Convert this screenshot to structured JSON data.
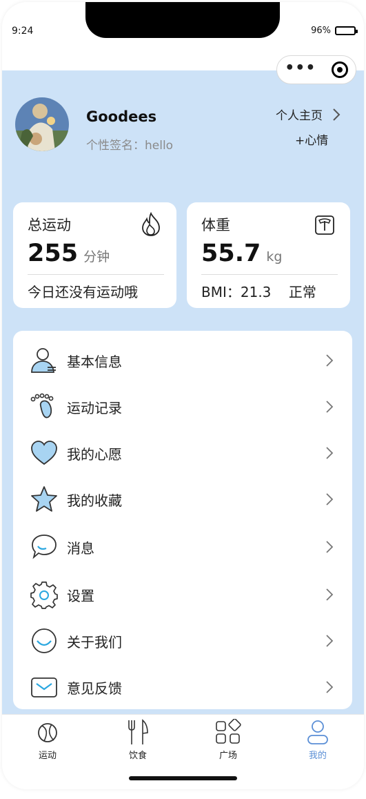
{
  "status": {
    "time": "9:24",
    "battery": "96%",
    "battery_level": 0.96
  },
  "profile": {
    "name": "Goodees",
    "signature": "个性签名：hello",
    "homepage_label": "个人主页",
    "mood_label": "+心情"
  },
  "cards": {
    "exercise": {
      "title": "总运动",
      "value": "255",
      "unit": "分钟",
      "footer": "今日还没有运动哦",
      "icon": "flame-icon"
    },
    "weight": {
      "title": "体重",
      "value": "55.7",
      "unit": "kg",
      "footer": "BMI：21.3    正常",
      "icon": "scale-icon"
    }
  },
  "menu": {
    "items": [
      {
        "label": "基本信息",
        "icon": "user-info-icon"
      },
      {
        "label": "运动记录",
        "icon": "footprint-icon"
      },
      {
        "label": "我的心愿",
        "icon": "heart-icon"
      },
      {
        "label": "我的收藏",
        "icon": "star-icon"
      },
      {
        "label": "消息",
        "icon": "chat-bubble-icon"
      },
      {
        "label": "设置",
        "icon": "gear-icon"
      },
      {
        "label": "关于我们",
        "icon": "smile-icon"
      },
      {
        "label": "意见反馈",
        "icon": "mail-icon"
      }
    ]
  },
  "tabbar": {
    "tabs": [
      {
        "label": "运动",
        "icon": "ball-icon",
        "active": false
      },
      {
        "label": "饮食",
        "icon": "fork-knife-icon",
        "active": false
      },
      {
        "label": "广场",
        "icon": "grid-icon",
        "active": false
      },
      {
        "label": "我的",
        "icon": "person-icon",
        "active": true
      }
    ]
  },
  "colors": {
    "page_bg": "#cde2f7",
    "accent": "#5b8fd6",
    "icon_fill": "#a8d4f2"
  }
}
